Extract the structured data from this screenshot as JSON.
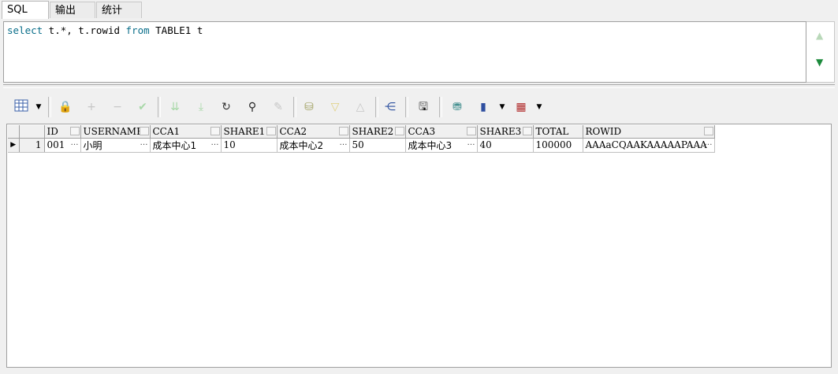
{
  "tabs": [
    "SQL",
    "输出",
    "统计"
  ],
  "editor": {
    "sql_keyword1": "select",
    "sql_part1": " t.*, t.rowid ",
    "sql_keyword2": "from",
    "sql_part2": " TABLE1 t"
  },
  "scroll": {
    "up_icon": "arrow-up-icon",
    "down_icon": "arrow-down-icon"
  },
  "toolbar": {
    "icons": [
      "grid-layout-icon",
      "lock-icon",
      "add-record-icon",
      "remove-record-icon",
      "post-changes-icon",
      "fetch-next-icon",
      "fetch-last-icon",
      "refresh-icon",
      "find-icon",
      "clear-icon",
      "query-by-example-icon",
      "next-record-icon",
      "previous-record-icon",
      "relations-icon",
      "save-icon",
      "export-icon",
      "chart-icon",
      "table-view-icon"
    ]
  },
  "grid": {
    "columns": [
      "ID",
      "USERNAME",
      "CCA1",
      "SHARE1",
      "CCA2",
      "SHARE2",
      "CCA3",
      "SHARE3",
      "TOTAL",
      "ROWID"
    ],
    "rows": [
      {
        "num": "1",
        "cells": [
          "001",
          "小明",
          "成本中心1",
          "10",
          "成本中心2",
          "50",
          "成本中心3",
          "40",
          "100000",
          "AAAaCQAAKAAAAAPAAA"
        ]
      }
    ]
  },
  "colors": {
    "keyword": "#0a6e8a",
    "down_arrow": "#1c8a3c"
  }
}
